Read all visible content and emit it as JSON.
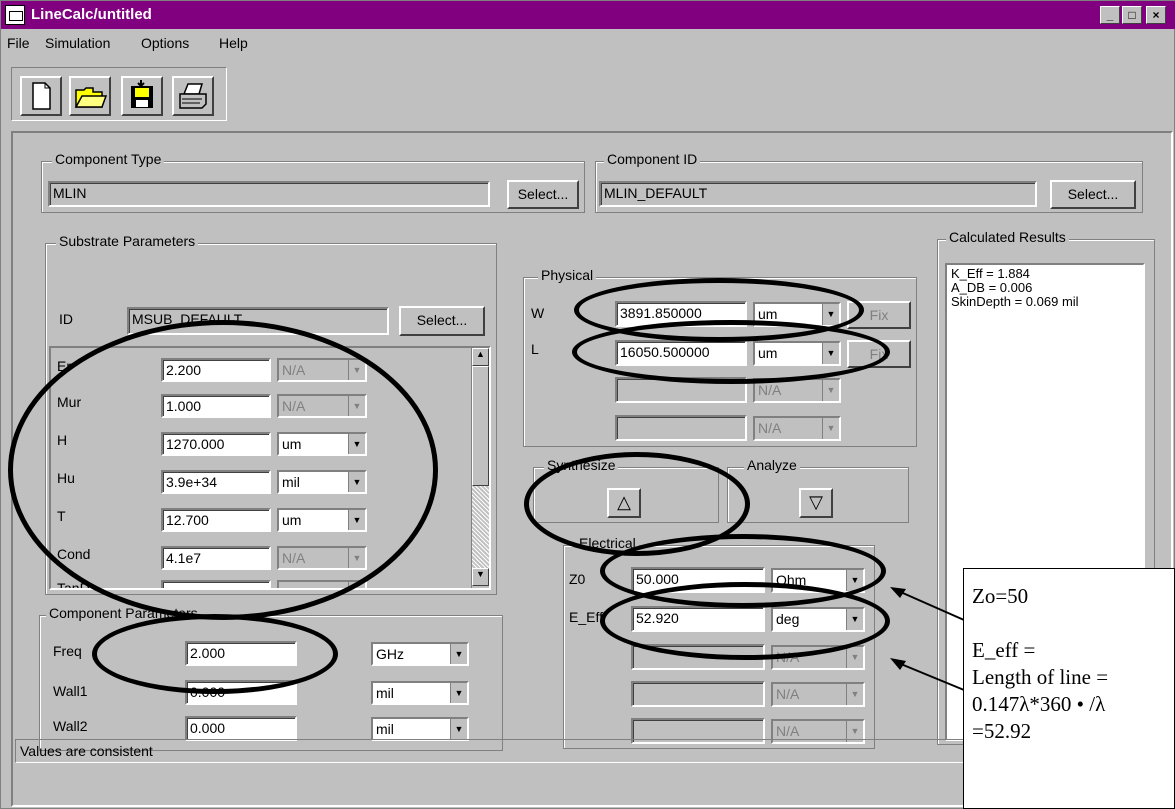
{
  "window": {
    "title": "LineCalc/untitled"
  },
  "menu": [
    "File",
    "Simulation",
    "Options",
    "Help"
  ],
  "component_type": {
    "label": "Component Type",
    "value": "MLIN",
    "select": "Select..."
  },
  "component_id": {
    "label": "Component ID",
    "value": "MLIN_DEFAULT",
    "select": "Select..."
  },
  "substrate": {
    "label": "Substrate Parameters",
    "id_label": "ID",
    "id_value": "MSUB_DEFAULT",
    "select": "Select...",
    "rows": [
      {
        "name": "Er",
        "value": "2.200",
        "unit": "N/A",
        "enabled": false
      },
      {
        "name": "Mur",
        "value": "1.000",
        "unit": "N/A",
        "enabled": false
      },
      {
        "name": "H",
        "value": "1270.000",
        "unit": "um",
        "enabled": true
      },
      {
        "name": "Hu",
        "value": "3.9e+34",
        "unit": "mil",
        "enabled": true
      },
      {
        "name": "T",
        "value": "12.700",
        "unit": "um",
        "enabled": true
      },
      {
        "name": "Cond",
        "value": "4.1e7",
        "unit": "N/A",
        "enabled": false
      },
      {
        "name": "TanD",
        "value": "",
        "unit": "",
        "enabled": false
      }
    ]
  },
  "component_params": {
    "label": "Component Parameters",
    "rows": [
      {
        "name": "Freq",
        "value": "2.000",
        "unit": "GHz"
      },
      {
        "name": "Wall1",
        "value": "0.000",
        "unit": "mil"
      },
      {
        "name": "Wall2",
        "value": "0.000",
        "unit": "mil"
      }
    ]
  },
  "physical": {
    "label": "Physical",
    "fix": "Fix",
    "rows": [
      {
        "name": "W",
        "value": "3891.850000",
        "unit": "um"
      },
      {
        "name": "L",
        "value": "16050.500000",
        "unit": "um"
      },
      {
        "name": "",
        "value": "",
        "unit": "N/A"
      },
      {
        "name": "",
        "value": "",
        "unit": "N/A"
      }
    ]
  },
  "synthesize": {
    "label": "Synthesize"
  },
  "analyze": {
    "label": "Analyze"
  },
  "electrical": {
    "label": "Electrical",
    "rows": [
      {
        "name": "Z0",
        "value": "50.000",
        "unit": "Ohm"
      },
      {
        "name": "E_Eff",
        "value": "52.920",
        "unit": "deg"
      },
      {
        "name": "",
        "value": "",
        "unit": "N/A"
      },
      {
        "name": "",
        "value": "",
        "unit": "N/A"
      },
      {
        "name": "",
        "value": "",
        "unit": "N/A"
      }
    ]
  },
  "results": {
    "label": "Calculated Results",
    "lines": [
      "K_Eff = 1.884",
      "A_DB = 0.006",
      "SkinDepth = 0.069 mil"
    ]
  },
  "status": "Values are consistent",
  "annotation": {
    "line1": "Zo=50",
    "line2": "E_eff =",
    "line3": "Length of line =",
    "line4": "0.147λ*360 • /λ",
    "line5": "=52.92"
  }
}
